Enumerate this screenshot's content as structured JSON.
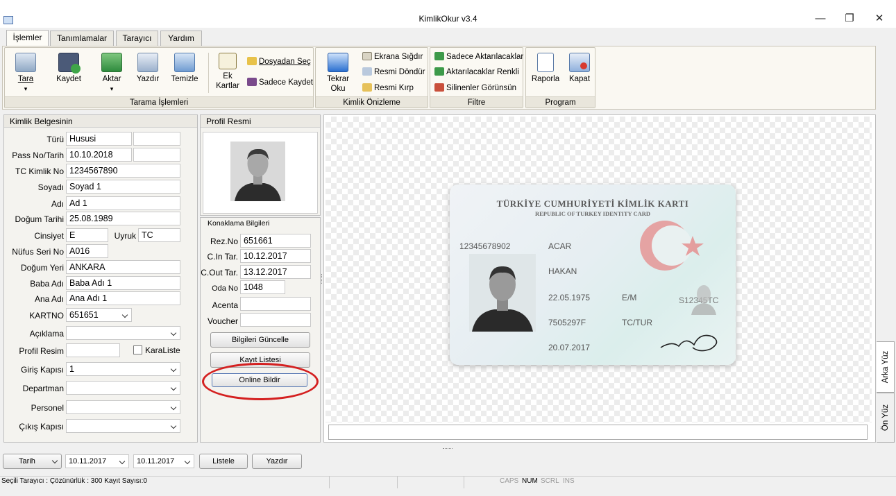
{
  "window": {
    "title": "KimlikOkur v3.4",
    "minimize": "—",
    "restore": "❐",
    "close": "✕"
  },
  "tabs": [
    "İşlemler",
    "Tanımlamalar",
    "Tarayıcı",
    "Yardım"
  ],
  "ribbon": {
    "groups": [
      "Tarama İşlemleri",
      "Kimlik Önizleme",
      "Filtre",
      "Program"
    ],
    "tara": "Tara",
    "kaydet": "Kaydet",
    "aktar": "Aktar",
    "yazdir": "Yazdır",
    "temizle": "Temizle",
    "ek_kartlar": "Ek Kartlar",
    "dosyadan_sec": "Dosyadan Seç",
    "sadece_kaydet": "Sadece Kaydet",
    "tekrar_oku": "Tekrar Oku",
    "ekrana_sigdir": "Ekrana Sığdır",
    "resmi_dondur": "Resmi Döndür",
    "resmi_kirp": "Resmi Kırp",
    "sadece_aktarilacaklar": "Sadece Aktarılacaklar",
    "aktarilacaklar_renkli": "Aktarılacaklar Renkli",
    "silinenler_gorunsun": "Silinenler Görünsün",
    "raporla": "Raporla",
    "kapat": "Kapat"
  },
  "kimlik": {
    "header": "Kimlik Belgesinin",
    "labels": {
      "turu": "Türü",
      "pass": "Pass No/Tarih",
      "tc": "TC Kimlik No",
      "soyadi": "Soyadı",
      "adi": "Adı",
      "dogum_tarihi": "Doğum Tarihi",
      "cinsiyet": "Cinsiyet",
      "uyruk": "Uyruk",
      "nufus": "Nüfus Seri No",
      "dogum_yeri": "Doğum Yeri",
      "baba": "Baba Adı",
      "ana": "Ana Adı",
      "kartno": "KARTNO",
      "aciklama": "Açıklama",
      "profil_resim": "Profil Resim",
      "karaliste": "KaraListe",
      "giris": "Giriş Kapısı",
      "departman": "Departman",
      "personel": "Personel",
      "cikis": "Çıkış Kapısı"
    },
    "values": {
      "turu": "Hususi",
      "pass": "10.10.2018",
      "tc": "1234567890",
      "soyadi": "Soyad 1",
      "adi": "Ad 1",
      "dogum_tarihi": "25.08.1989",
      "cinsiyet": "E",
      "uyruk": "TC",
      "nufus": "A016",
      "dogum_yeri": "ANKARA",
      "baba": "Baba Adı 1",
      "ana": "Ana Adı 1",
      "kartno": "651651",
      "giris": "1"
    }
  },
  "profil": {
    "header": "Profil Resmi"
  },
  "konaklama": {
    "header": "Konaklama Bilgileri",
    "labels": {
      "rezno": "Rez.No",
      "cin": "C.In Tar.",
      "cout": "C.Out Tar.",
      "oda": "Oda No",
      "acenta": "Acenta",
      "voucher": "Voucher"
    },
    "values": {
      "rezno": "651661",
      "cin": "10.12.2017",
      "cout": "13.12.2017",
      "oda": "1048"
    },
    "buttons": {
      "guncelle": "Bilgileri Güncelle",
      "kayit": "Kayıt Listesi",
      "online": "Online Bildir"
    }
  },
  "card": {
    "title": "TÜRKİYE CUMHURİYETİ KİMLİK KARTI",
    "subtitle": "REPUBLIC OF TURKEY IDENTITY CARD",
    "tc": "12345678902",
    "surname": "ACAR",
    "name": "HAKAN",
    "dob": "22.05.1975",
    "gender": "E/M",
    "serial": "7505297F",
    "nationality": "TC/TUR",
    "valid": "20.07.2017",
    "doc_no": "S12345TC"
  },
  "side_tabs": {
    "arka": "Arka Yüz",
    "on": "Ön Yüz"
  },
  "bottom": {
    "tarih": "Tarih",
    "date1": "10.11.2017",
    "date2": "10.11.2017",
    "listele": "Listele",
    "yazdir": "Yazdır"
  },
  "status": {
    "left": "Seçili Tarayıcı :  Çözünürlük : 300 Kayıt Sayısı:0",
    "caps": "CAPS",
    "num": "NUM",
    "scrl": "SCRL",
    "ins": "INS"
  },
  "colors": {
    "highlight_ring": "#d42020",
    "accent": "#3a6fc4"
  }
}
